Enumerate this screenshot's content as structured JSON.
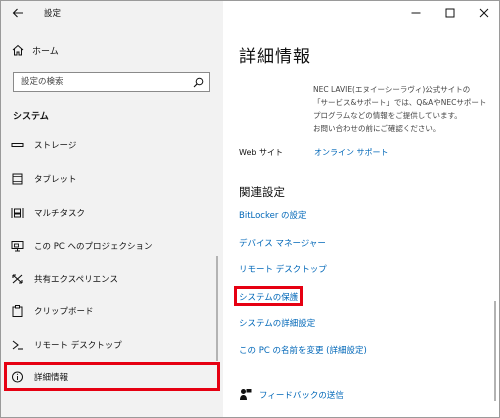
{
  "app": {
    "title": "設定"
  },
  "sidebar": {
    "home_label": "ホーム",
    "search_placeholder": "設定の検索",
    "section_title": "システム",
    "items": [
      {
        "label": "ストレージ",
        "icon": "storage-icon"
      },
      {
        "label": "タブレット",
        "icon": "tablet-icon"
      },
      {
        "label": "マルチタスク",
        "icon": "multitask-icon"
      },
      {
        "label": "この PC へのプロジェクション",
        "icon": "projection-icon"
      },
      {
        "label": "共有エクスペリエンス",
        "icon": "shared-experience-icon"
      },
      {
        "label": "クリップボード",
        "icon": "clipboard-icon"
      },
      {
        "label": "リモート デスクトップ",
        "icon": "remote-desktop-icon"
      },
      {
        "label": "詳細情報",
        "icon": "info-icon",
        "active": true
      }
    ]
  },
  "main": {
    "title": "詳細情報",
    "info_lines": [
      "NEC LAVIE(エヌイーシーラヴィ)公式サイトの",
      "「サービス&サポート」では、Q&AやNECサポート",
      "プログラムなどの情報をご提供しています。",
      "お問い合わせの前にご確認ください。"
    ],
    "web_label": "Web サイト",
    "web_link": "オンライン サポート",
    "related_title": "関連設定",
    "related_links": [
      "BitLocker の設定",
      "デバイス マネージャー",
      "リモート デスクトップ",
      "システムの保護",
      "システムの詳細設定",
      "この PC の名前を変更 (詳細設定)"
    ],
    "feedback_label": "フィードバックの送信"
  },
  "colors": {
    "accent": "#0067b8",
    "highlight": "#e60012",
    "sidebar_bg": "#f2f2f2"
  }
}
